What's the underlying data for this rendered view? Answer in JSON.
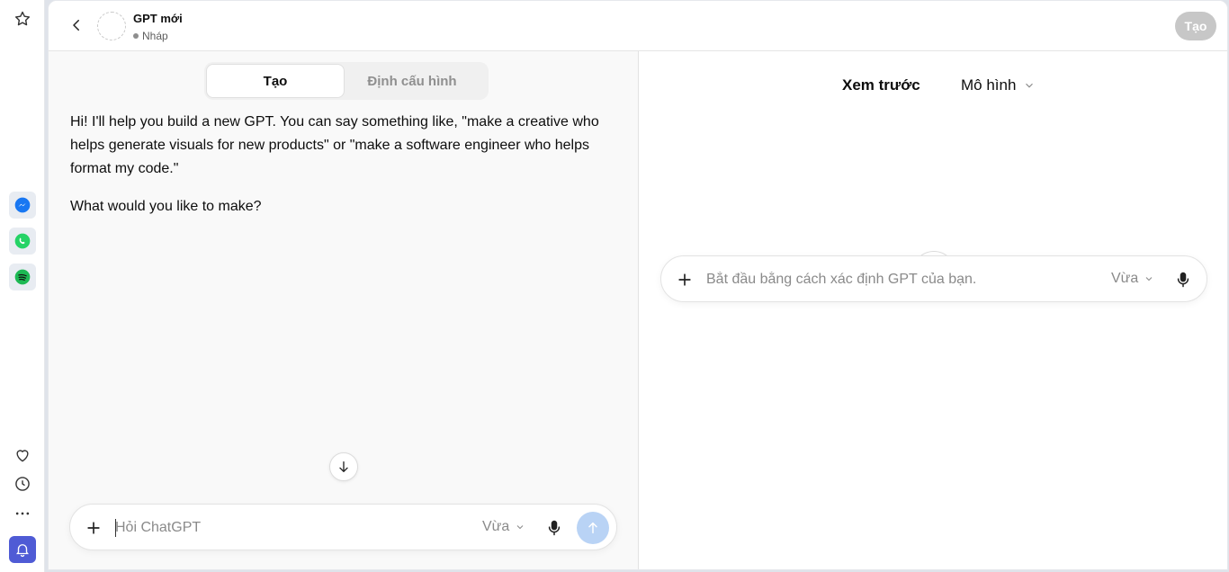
{
  "header": {
    "back_icon": "chevron-left-icon",
    "gpt_name": "GPT mới",
    "gpt_status": "Nháp",
    "create_button": "Tạo"
  },
  "tabs": {
    "create": "Tạo",
    "configure": "Định cấu hình"
  },
  "conversation": {
    "message_1": "Hi! I'll help you build a new GPT. You can say something like, \"make a creative who helps generate visuals for new products\" or \"make a software engineer who helps format my code.\"",
    "message_2": "What would you like to make?"
  },
  "composer": {
    "placeholder": "Hỏi ChatGPT",
    "mode": "Vừa"
  },
  "preview": {
    "title": "Xem trước",
    "model_label": "Mô hình",
    "composer_placeholder": "Bắt đầu bằng cách xác định GPT của bạn.",
    "composer_mode": "Vừa"
  },
  "sidebar": {
    "icons": [
      "star-icon",
      "messenger-icon",
      "whatsapp-icon",
      "spotify-icon",
      "heart-icon",
      "clock-icon",
      "more-icon",
      "notification-icon"
    ]
  },
  "colors": {
    "accent_blue": "#1877f2",
    "whatsapp_green": "#25d366",
    "spotify_green": "#1db954",
    "send_disabled": "#b9d3f5",
    "create_disabled": "#c7c7c7"
  }
}
